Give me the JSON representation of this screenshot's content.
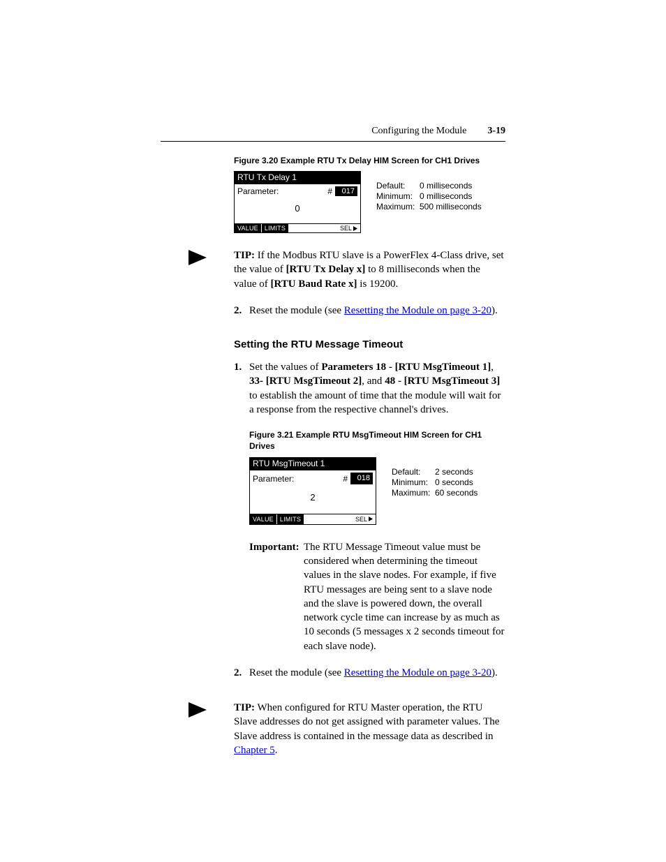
{
  "header": {
    "section": "Configuring the Module",
    "page": "3-19"
  },
  "figure1": {
    "caption": "Figure 3.20   Example RTU Tx Delay HIM Screen for CH1 Drives",
    "him": {
      "title": "RTU Tx Delay 1",
      "param_label": "Parameter:",
      "hash": "#",
      "num": "017",
      "value": "0",
      "btn_value": "VALUE",
      "btn_limits": "LIMITS",
      "sel": "SEL"
    },
    "meta": {
      "default_k": "Default:",
      "default_v": "0 milliseconds",
      "min_k": "Minimum:",
      "min_v": "0 milliseconds",
      "max_k": "Maximum:",
      "max_v": "500 milliseconds"
    }
  },
  "tip1": {
    "label": "TIP:",
    "text_pre": "If the Modbus RTU slave is a PowerFlex 4-Class drive, set the value of ",
    "b1": "[RTU Tx Delay x]",
    "text_mid": " to 8 milliseconds when the value of ",
    "b2": "[RTU Baud Rate x]",
    "text_post": " is 19200."
  },
  "step2a": {
    "pre": "Reset the module (see ",
    "link": "Resetting the Module on page 3-20",
    "post": ")."
  },
  "section2": {
    "heading": "Setting the RTU Message Timeout"
  },
  "step1b": {
    "pre": "Set the values of ",
    "b1": "Parameters 18 - [RTU MsgTimeout 1]",
    "c1": ", ",
    "b2": "33- [RTU MsgTimeout 2]",
    "c2": ", and ",
    "b3": "48 - [RTU MsgTimeout 3]",
    "post": " to establish the amount of time that the module will wait for a response from the respective channel's drives."
  },
  "figure2": {
    "caption": "Figure 3.21   Example RTU MsgTimeout HIM Screen for CH1 Drives",
    "him": {
      "title": "RTU MsgTimeout 1",
      "param_label": "Parameter:",
      "hash": "#",
      "num": "018",
      "value": "2",
      "btn_value": "VALUE",
      "btn_limits": "LIMITS",
      "sel": "SEL"
    },
    "meta": {
      "default_k": "Default:",
      "default_v": "2 seconds",
      "min_k": "Minimum:",
      "min_v": "0 seconds",
      "max_k": "Maximum:",
      "max_v": "60 seconds"
    }
  },
  "important": {
    "label": "Important:",
    "text": "The RTU Message Timeout value must be considered when determining the timeout values in the slave nodes. For example, if five RTU messages are being sent to a slave node and the slave is powered down, the overall network cycle time can increase by as much as 10 seconds (5 messages x 2 seconds timeout for each slave node)."
  },
  "step2b": {
    "pre": "Reset the module (see ",
    "link": "Resetting the Module on page 3-20",
    "post": ")."
  },
  "tip2": {
    "label": "TIP:",
    "text_pre": "When configured for RTU Master operation, the RTU Slave addresses do not get assigned with parameter values. The Slave address is contained in the message data as described in ",
    "link": "Chapter 5",
    "post": "."
  }
}
